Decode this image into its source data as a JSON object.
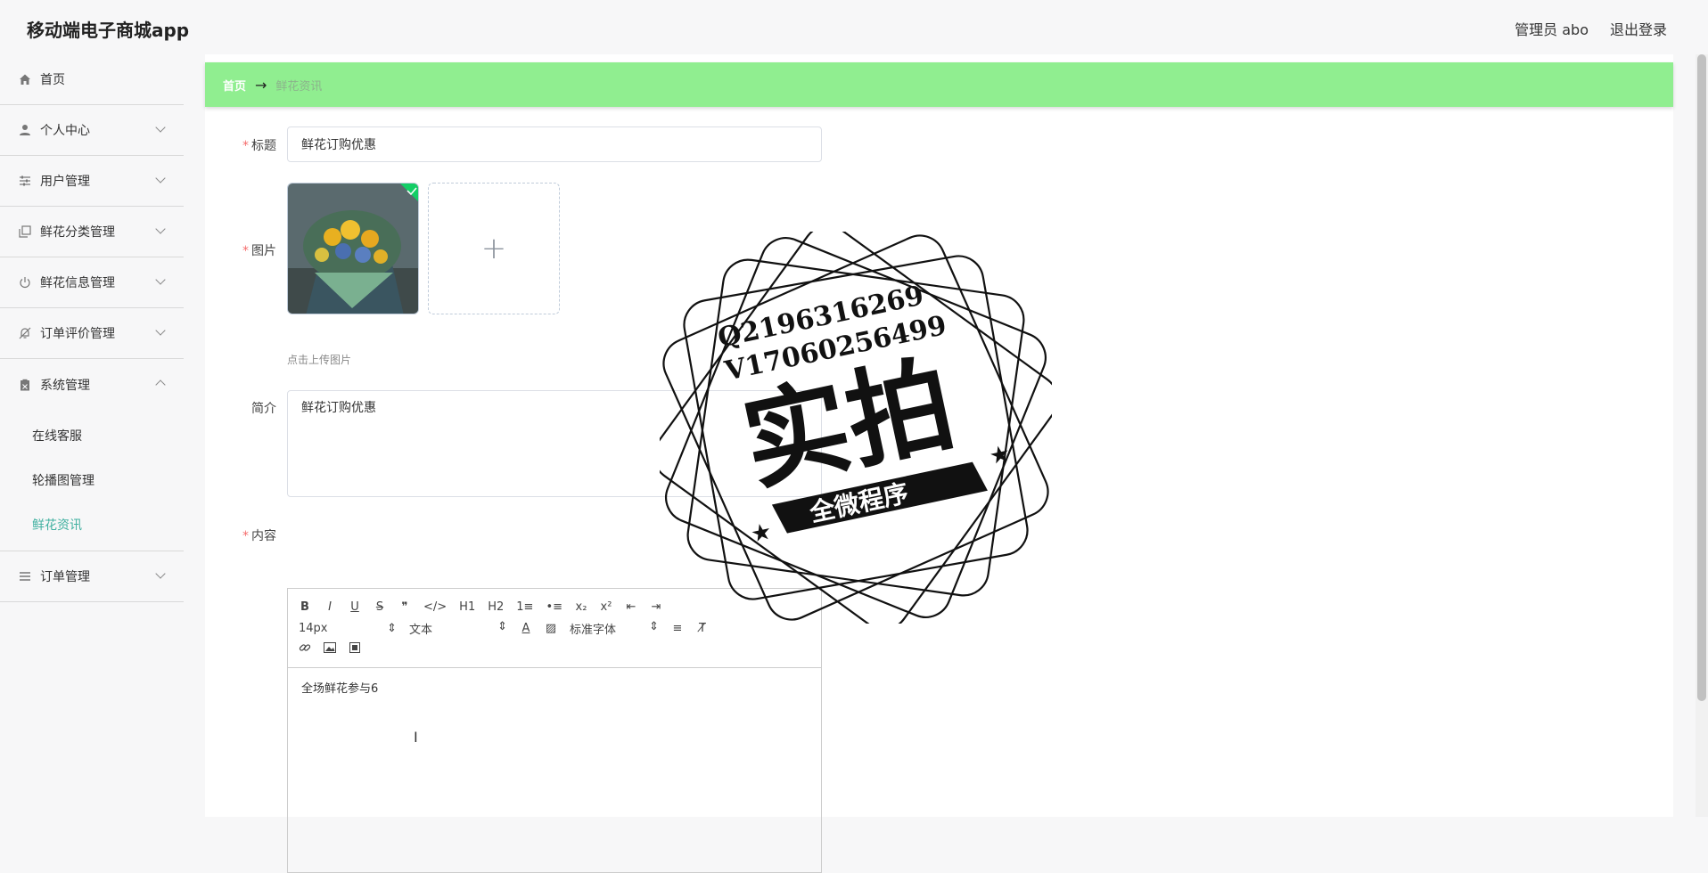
{
  "app": {
    "title": "移动端电子商城app"
  },
  "header": {
    "user_label": "管理员 abo",
    "logout_label": "退出登录"
  },
  "sidebar": {
    "items": [
      {
        "label": "首页",
        "icon": "home-icon"
      },
      {
        "label": "个人中心",
        "icon": "user-icon"
      },
      {
        "label": "用户管理",
        "icon": "sliders-icon"
      },
      {
        "label": "鲜花分类管理",
        "icon": "copy-icon"
      },
      {
        "label": "鲜花信息管理",
        "icon": "power-icon"
      },
      {
        "label": "订单评价管理",
        "icon": "bell-off-icon"
      },
      {
        "label": "系统管理",
        "icon": "clipboard-icon"
      },
      {
        "label": "订单管理",
        "icon": "list-icon"
      }
    ],
    "system_submenu": [
      {
        "label": "在线客服"
      },
      {
        "label": "轮播图管理"
      },
      {
        "label": "鲜花资讯",
        "active": true
      }
    ]
  },
  "breadcrumb": {
    "home": "首页",
    "arrow": "→",
    "current": "鲜花资讯"
  },
  "form": {
    "title": {
      "label": "标题",
      "value": "鲜花订购优惠"
    },
    "image": {
      "label": "图片",
      "tip": "点击上传图片"
    },
    "intro": {
      "label": "简介",
      "value": "鲜花订购优惠"
    },
    "content": {
      "label": "内容",
      "toolbar": {
        "row1": [
          "B",
          "I",
          "U",
          "S",
          "❞",
          "</>",
          "H1",
          "H2",
          "1≡",
          "•≡",
          "x₂",
          "x²",
          "⇤",
          "⇥"
        ],
        "font_size": "14px",
        "header": "文本",
        "font_family": "标准字体",
        "row3": [
          "link",
          "image",
          "video"
        ]
      },
      "text": "全场鲜花参与6"
    }
  },
  "watermark": {
    "line1": "Q2196316269",
    "line2": "V17060256499",
    "big": "实拍",
    "banner": "全微程序"
  },
  "colors": {
    "accent": "#40b0a0",
    "breadcrumb_bg": "#90ee90",
    "required": "#f56c6c"
  }
}
